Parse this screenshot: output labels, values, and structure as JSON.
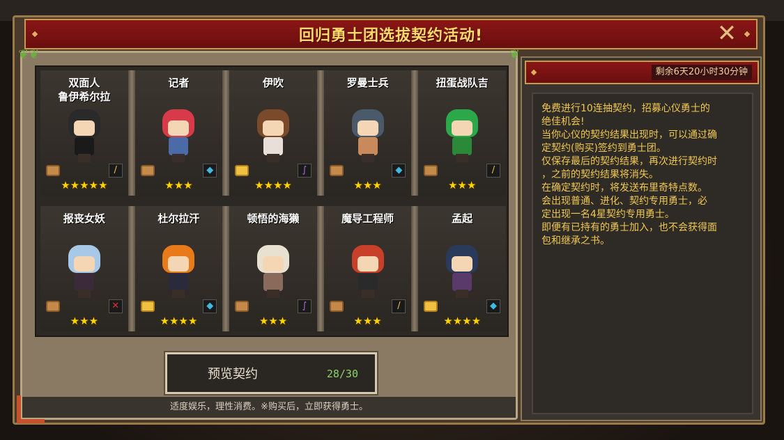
{
  "dialog": {
    "title": "回归勇士团选拔契约活动!",
    "close_icon": "close-x-icon"
  },
  "timer": {
    "text": "剩余6天20小时30分钟"
  },
  "heroes": [
    {
      "name": "双面人\n鲁伊希尔拉",
      "stars": "★★★★★",
      "scroll": "normal",
      "weapon": "sword",
      "weapon_glyph": "/",
      "hair": "#2a2a2a",
      "outfit": "#1a1a1a"
    },
    {
      "name": "记者",
      "stars": "★★★",
      "scroll": "normal",
      "weapon": "bow",
      "weapon_glyph": "◆",
      "hair": "#d83a4a",
      "outfit": "#4a6aa8"
    },
    {
      "name": "伊吹",
      "stars": "★★★★",
      "scroll": "gold",
      "weapon": "staff",
      "weapon_glyph": "∫",
      "hair": "#7a4a2a",
      "outfit": "#e8e0d8"
    },
    {
      "name": "罗曼士兵",
      "stars": "★★★",
      "scroll": "normal",
      "weapon": "bow",
      "weapon_glyph": "◆",
      "hair": "#4a5a6a",
      "outfit": "#c88a5a"
    },
    {
      "name": "扭蛋战队吉",
      "stars": "★★★",
      "scroll": "normal",
      "weapon": "sword",
      "weapon_glyph": "/",
      "hair": "#2aa84a",
      "outfit": "#2a8a3a"
    },
    {
      "name": "报丧女妖",
      "stars": "★★★",
      "scroll": "normal",
      "weapon": "cross",
      "weapon_glyph": "✕",
      "hair": "#a8c8e8",
      "outfit": "#3a2a3a"
    },
    {
      "name": "杜尔拉汗",
      "stars": "★★★★",
      "scroll": "gold",
      "weapon": "bow",
      "weapon_glyph": "◆",
      "hair": "#e87a1a",
      "outfit": "#2a2a3a"
    },
    {
      "name": "顿悟的海獭",
      "stars": "★★★",
      "scroll": "normal",
      "weapon": "staff",
      "weapon_glyph": "∫",
      "hair": "#e8e0d0",
      "outfit": "#8a6a5a"
    },
    {
      "name": "魔导工程师",
      "stars": "★★★",
      "scroll": "normal",
      "weapon": "sword",
      "weapon_glyph": "/",
      "hair": "#c8402a",
      "outfit": "#2a2a2a"
    },
    {
      "name": "孟起",
      "stars": "★★★★",
      "scroll": "gold",
      "weapon": "bow",
      "weapon_glyph": "◆",
      "hair": "#2a3a5a",
      "outfit": "#5a3a6a"
    }
  ],
  "preview": {
    "label": "预览契约",
    "count": "28/30"
  },
  "notice": "适度娱乐，理性消费。※购买后，立即获得勇士。",
  "description": [
    "免费进行10连抽契约，招募心仪勇士的",
    "绝佳机会!",
    "当你心仪的契约结果出现时，可以通过确",
    "定契约(购买)签约到勇士团。",
    "仅保存最后的契约结果，再次进行契约时",
    "，之前的契约结果将消失。",
    "在确定契约时，将发送布里奇特点数。",
    "会出现普通、进化、契约专用勇士，必",
    "定出现一名4星契约专用勇士。",
    "即便有已持有的勇士加入，也不会获得面",
    "包和继承之书。"
  ],
  "colors": {
    "title_text": "#ffd96a",
    "desc_text": "#f0c850",
    "star": "#ffd400",
    "counter": "#8ad46a",
    "banner": "#8a1616"
  }
}
